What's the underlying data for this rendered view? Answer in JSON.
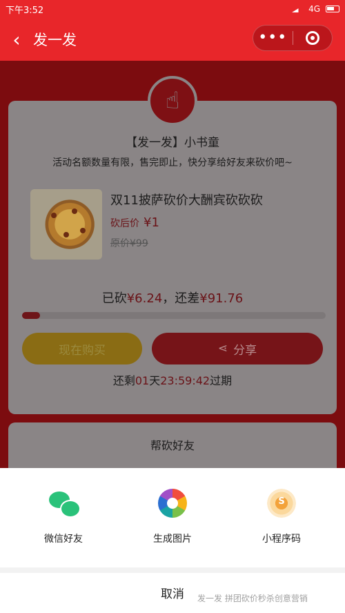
{
  "status_bar": {
    "time": "下午3:52",
    "network": "4G"
  },
  "nav": {
    "back_icon": "back-chevron-icon",
    "title": "发一发",
    "more_icon": "more-dots-icon",
    "close_icon": "target-circle-icon"
  },
  "activity": {
    "title": "【发一发】小书童",
    "subtitle": "活动名额数量有限，售完即止，快分享给好友来砍价吧~"
  },
  "product": {
    "name": "双11披萨砍价大酬宾砍砍砍",
    "price_label": "砍后价",
    "price": "¥1",
    "original_price": "原价¥99"
  },
  "bargain": {
    "prefix": "已砍",
    "cut_amount": "¥6.24",
    "middle": "，还差",
    "remaining": "¥91.76",
    "progress_percent": 6
  },
  "buttons": {
    "buy": "现在购买",
    "share": "分享",
    "share_icon": "share-icon"
  },
  "countdown": {
    "prefix": "还剩",
    "days": "01",
    "day_unit": "天",
    "time": "23:59:42",
    "suffix": "过期"
  },
  "helpers": {
    "title": "帮砍好友"
  },
  "share_sheet": {
    "options": [
      {
        "label": "微信好友",
        "icon": "wechat-icon"
      },
      {
        "label": "生成图片",
        "icon": "photo-aperture-icon"
      },
      {
        "label": "小程序码",
        "icon": "mini-program-code-icon"
      }
    ],
    "cancel": "取消"
  },
  "watermark": "发一发 拼团砍价秒杀创意营销"
}
